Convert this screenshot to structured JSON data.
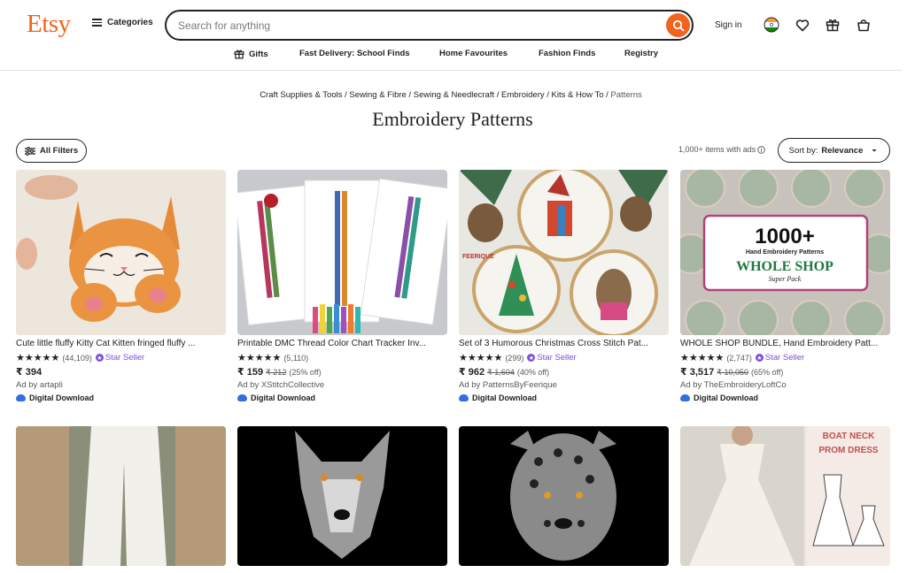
{
  "header": {
    "logo": "Etsy",
    "categories_label": "Categories",
    "search_placeholder": "Search for anything",
    "sign_in": "Sign in"
  },
  "subnav": [
    {
      "label": "Gifts"
    },
    {
      "label": "Fast Delivery: School Finds"
    },
    {
      "label": "Home Favourites"
    },
    {
      "label": "Fashion Finds"
    },
    {
      "label": "Registry"
    }
  ],
  "breadcrumb": {
    "items": [
      "Craft Supplies & Tools",
      "Sewing & Fibre",
      "Sewing & Needlecraft",
      "Embroidery",
      "Kits & How To"
    ],
    "separator": " / ",
    "current": "Patterns"
  },
  "page_title": "Embroidery Patterns",
  "filters_label": "All Filters",
  "results_text": "1,000+ items with ads",
  "sort": {
    "prefix": "Sort by:",
    "value": "Relevance"
  },
  "products": [
    {
      "title": "Cute little fluffy Kitty Cat Kitten fringed fluffy ...",
      "stars": "★★★★★",
      "reviews": "(44,109)",
      "star_seller": "Star Seller",
      "price": "₹ 394",
      "original_price": "",
      "discount": "",
      "shop": "Ad by artapli",
      "badge": "Digital Download"
    },
    {
      "title": "Printable DMC Thread Color Chart Tracker Inv...",
      "stars": "★★★★★",
      "reviews": "(5,110)",
      "star_seller": "",
      "price": "₹ 159",
      "original_price": "₹ 212",
      "discount": "(25% off)",
      "shop": "Ad by XStitchCollective",
      "badge": "Digital Download"
    },
    {
      "title": "Set of 3 Humorous Christmas Cross Stitch Pat...",
      "stars": "★★★★★",
      "reviews": "(299)",
      "star_seller": "Star Seller",
      "price": "₹ 962",
      "original_price": "₹ 1,604",
      "discount": "(40% off)",
      "shop": "Ad by PatternsByFeerique",
      "badge": "Digital Download"
    },
    {
      "title": "WHOLE SHOP BUNDLE, Hand Embroidery Patt...",
      "stars": "★★★★★",
      "reviews": "(2,747)",
      "star_seller": "Star Seller",
      "price": "₹ 3,517",
      "original_price": "₹ 10,050",
      "discount": "(65% off)",
      "shop": "Ad by TheEmbroideryLoftCo",
      "badge": "Digital Download"
    }
  ],
  "product_image_text": {
    "feerique": "FEERIQUE",
    "whole_shop_big": "1000+",
    "whole_shop_sub": "Hand Embroidery Patterns",
    "whole_shop_main": "WHOLE SHOP",
    "whole_shop_pack": "Super Pack",
    "boat_neck_1": "BOAT NECK",
    "boat_neck_2": "PROM DRESS"
  },
  "colors": {
    "brand_orange": "#F1641E",
    "star_seller_purple": "#7b4fd8",
    "download_blue": "#2f6ee5",
    "text": "#222222"
  },
  "icons": [
    "hamburger-icon",
    "search-icon",
    "india-flag-icon",
    "heart-icon",
    "gift-icon",
    "bag-icon",
    "filters-icon",
    "info-icon",
    "caret-down-icon",
    "cloud-download-icon"
  ]
}
